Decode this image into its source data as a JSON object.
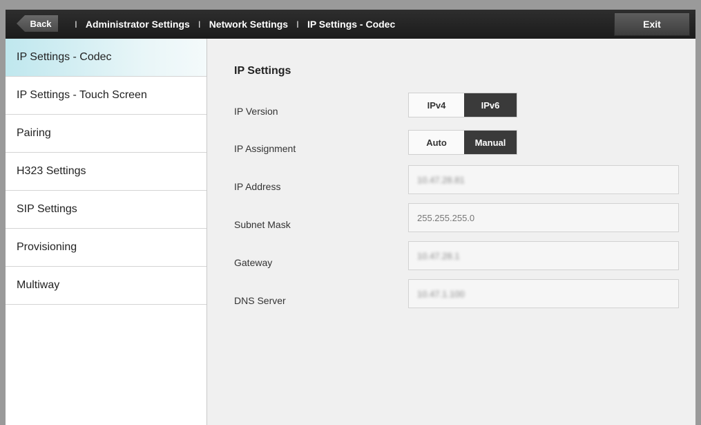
{
  "header": {
    "back_label": "Back",
    "breadcrumbs": [
      "Administrator Settings",
      "Network Settings",
      "IP Settings - Codec"
    ],
    "separator": "I",
    "exit_label": "Exit"
  },
  "sidebar": {
    "items": [
      {
        "label": "IP Settings - Codec",
        "active": true
      },
      {
        "label": "IP Settings - Touch Screen",
        "active": false
      },
      {
        "label": "Pairing",
        "active": false
      },
      {
        "label": "H323 Settings",
        "active": false
      },
      {
        "label": "SIP Settings",
        "active": false
      },
      {
        "label": "Provisioning",
        "active": false
      },
      {
        "label": "Multiway",
        "active": false
      }
    ]
  },
  "main": {
    "section_title": "IP Settings",
    "ip_version": {
      "label": "IP Version",
      "options": [
        "IPv4",
        "IPv6"
      ],
      "selected": "IPv6"
    },
    "ip_assignment": {
      "label": "IP Assignment",
      "options": [
        "Auto",
        "Manual"
      ],
      "selected": "Manual"
    },
    "ip_address": {
      "label": "IP Address",
      "value": "10.47.28.81"
    },
    "subnet_mask": {
      "label": "Subnet Mask",
      "value": "255.255.255.0"
    },
    "gateway": {
      "label": "Gateway",
      "value": "10.47.28.1"
    },
    "dns_server": {
      "label": "DNS Server",
      "value": "10.47.1.100"
    }
  },
  "colors": {
    "topbar": "#1f1f1f",
    "active_item": "#bfe7ee",
    "selected_option": "#3a3a3a"
  }
}
